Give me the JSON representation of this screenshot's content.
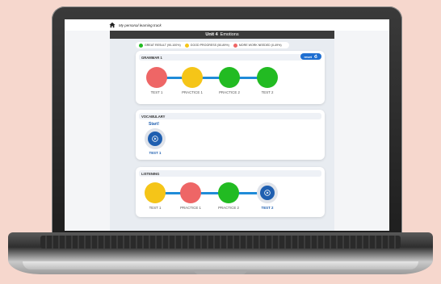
{
  "app": {
    "title": "My personal learning track"
  },
  "unit": {
    "label": "Unit 4",
    "name": "Emotions"
  },
  "legend": [
    {
      "label": "GREAT RESULT (90-100%)",
      "color": "#22bb22"
    },
    {
      "label": "GOOD PROGRESS (50-89%)",
      "color": "#f5c518"
    },
    {
      "label": "MORE WORK NEEDED (0-49%)",
      "color": "#ee6666"
    }
  ],
  "colors": {
    "accent": "#1f6fd1",
    "track": "#1f8bd8",
    "red": "#ee6666",
    "yellow": "#f5c518",
    "green": "#22bb22",
    "dark": "#3b3b3b"
  },
  "sections": {
    "grammar": {
      "title": "GRAMMAR 1",
      "reset_label": "reset",
      "steps": [
        {
          "label": "TEST 1",
          "status": "red"
        },
        {
          "label": "PRACTICE 1",
          "status": "yellow"
        },
        {
          "label": "PRACTICE 2",
          "status": "green"
        },
        {
          "label": "TEST 2",
          "status": "green"
        }
      ]
    },
    "vocabulary": {
      "title": "VOCABULARY",
      "start_label": "Start!",
      "steps": [
        {
          "label": "TEST 1",
          "status": "play"
        }
      ]
    },
    "listening": {
      "title": "LISTENING",
      "steps": [
        {
          "label": "TEST 1",
          "status": "yellow"
        },
        {
          "label": "PRACTICE 1",
          "status": "red"
        },
        {
          "label": "PRACTICE 2",
          "status": "green"
        },
        {
          "label": "TEST 2",
          "status": "play"
        }
      ]
    }
  }
}
